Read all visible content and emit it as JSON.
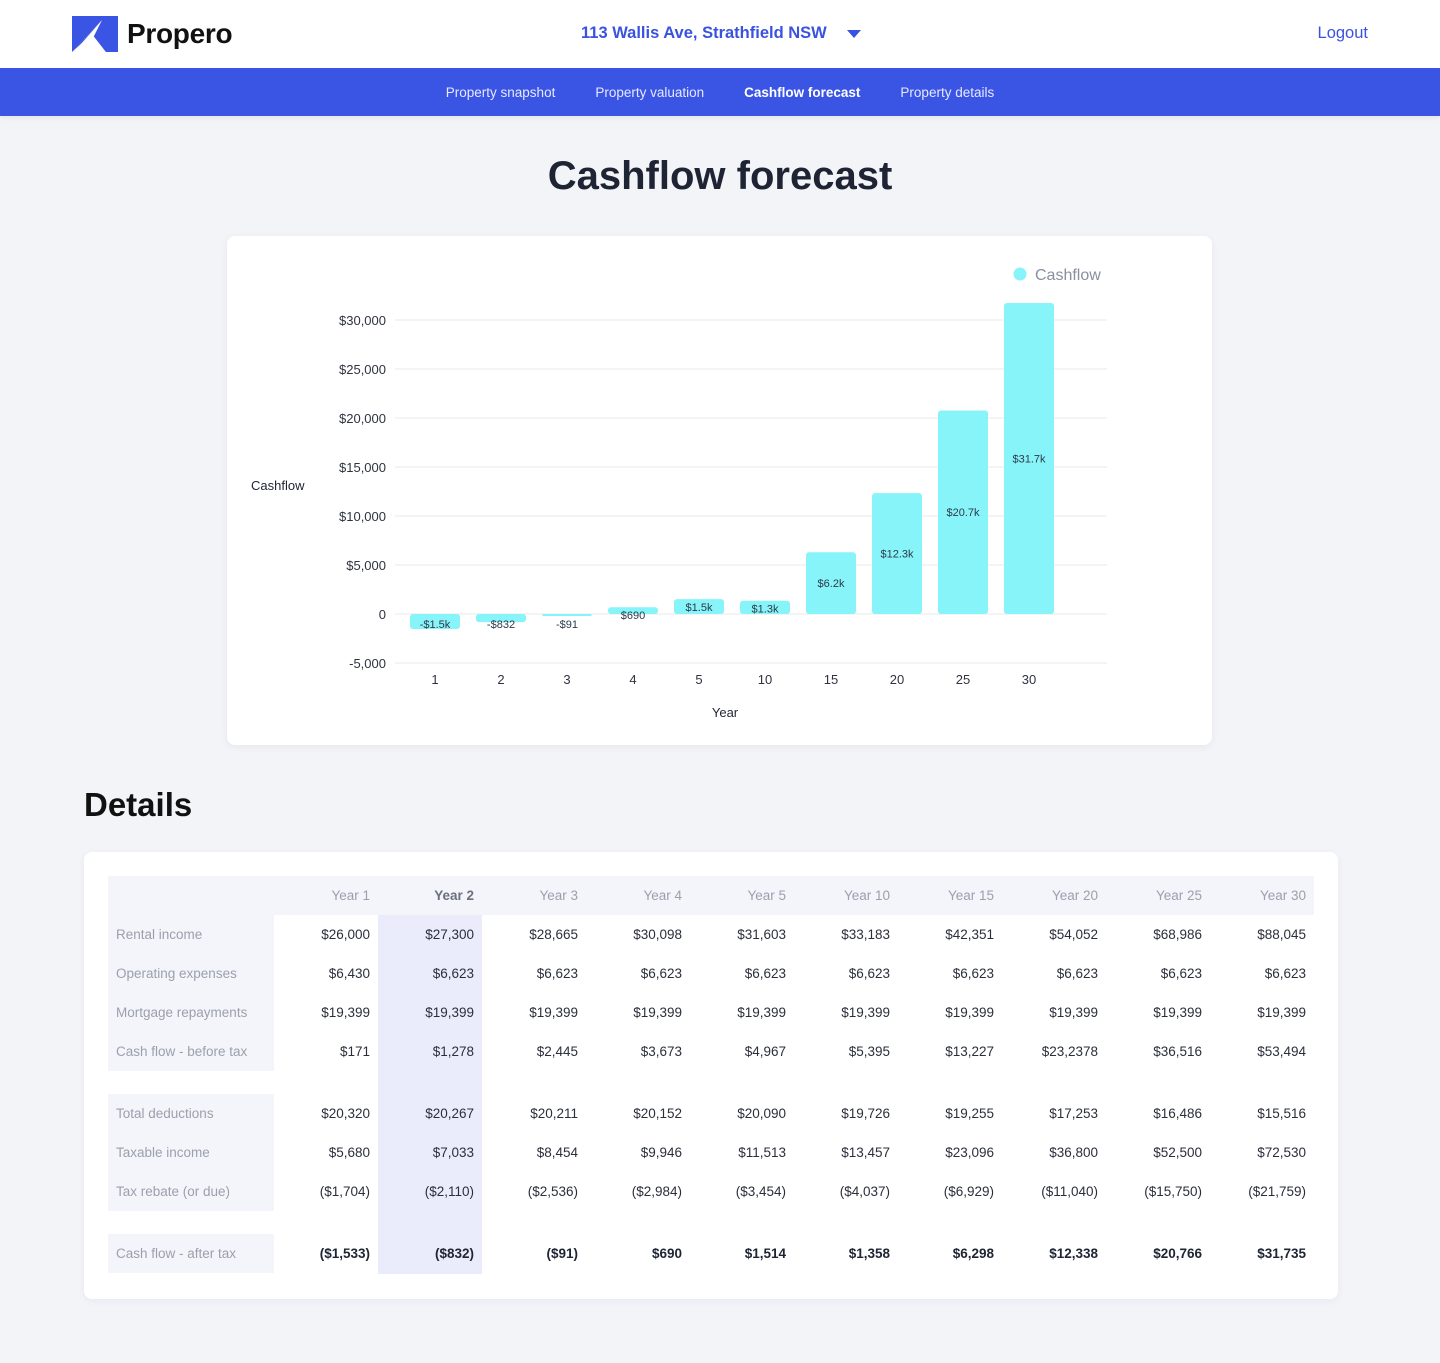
{
  "header": {
    "logo_text": "Propero",
    "address": "113 Wallis Ave, Strathfield NSW",
    "logout_label": "Logout"
  },
  "nav": {
    "items": [
      {
        "label": "Property snapshot",
        "active": false
      },
      {
        "label": "Property valuation",
        "active": false
      },
      {
        "label": "Cashflow forecast",
        "active": true
      },
      {
        "label": "Property details",
        "active": false
      }
    ]
  },
  "page": {
    "title": "Cashflow forecast",
    "details_title": "Details"
  },
  "colors": {
    "brand": "#3a55e4",
    "bar": "#86f4f8",
    "highlight_column": "#ebecfb"
  },
  "chart_data": {
    "type": "bar",
    "title": "",
    "xlabel": "Year",
    "ylabel": "Cashflow",
    "legend": [
      {
        "name": "Cashflow",
        "position": "top-right"
      }
    ],
    "categories": [
      "1",
      "2",
      "3",
      "4",
      "5",
      "10",
      "15",
      "20",
      "25",
      "30"
    ],
    "values": [
      -1533,
      -832,
      -91,
      690,
      1514,
      1358,
      6298,
      12338,
      20766,
      31735
    ],
    "data_labels": [
      "-$1.5k",
      "-$832",
      "-$91",
      "$690",
      "$1.5k",
      "$1.3k",
      "$6.2k",
      "$12.3k",
      "$20.7k",
      "$31.7k"
    ],
    "ylim": [
      -5000,
      30000
    ],
    "yticks": [
      30000,
      25000,
      20000,
      15000,
      10000,
      5000,
      0,
      -5000
    ],
    "ytick_labels": [
      "$30,000",
      "$25,000",
      "$20,000",
      "$15,000",
      "$10,000",
      "$5,000",
      "0",
      "-5,000"
    ],
    "grid": true
  },
  "table": {
    "columns": [
      "Year 1",
      "Year 2",
      "Year 3",
      "Year 4",
      "Year 5",
      "Year 10",
      "Year 15",
      "Year 20",
      "Year 25",
      "Year 30"
    ],
    "highlighted_column": "Year 2",
    "groups": [
      {
        "rows": [
          {
            "label": "Rental income",
            "values": [
              "$26,000",
              "$27,300",
              "$28,665",
              "$30,098",
              "$31,603",
              "$33,183",
              "$42,351",
              "$54,052",
              "$68,986",
              "$88,045"
            ]
          },
          {
            "label": "Operating expenses",
            "values": [
              "$6,430",
              "$6,623",
              "$6,623",
              "$6,623",
              "$6,623",
              "$6,623",
              "$6,623",
              "$6,623",
              "$6,623",
              "$6,623"
            ]
          },
          {
            "label": "Mortgage repayments",
            "values": [
              "$19,399",
              "$19,399",
              "$19,399",
              "$19,399",
              "$19,399",
              "$19,399",
              "$19,399",
              "$19,399",
              "$19,399",
              "$19,399"
            ]
          },
          {
            "label": "Cash flow - before tax",
            "values": [
              "$171",
              "$1,278",
              "$2,445",
              "$3,673",
              "$4,967",
              "$5,395",
              "$13,227",
              "$23,2378",
              "$36,516",
              "$53,494"
            ]
          }
        ]
      },
      {
        "rows": [
          {
            "label": "Total deductions",
            "values": [
              "$20,320",
              "$20,267",
              "$20,211",
              "$20,152",
              "$20,090",
              "$19,726",
              "$19,255",
              "$17,253",
              "$16,486",
              "$15,516"
            ]
          },
          {
            "label": "Taxable income",
            "values": [
              "$5,680",
              "$7,033",
              "$8,454",
              "$9,946",
              "$11,513",
              "$13,457",
              "$23,096",
              "$36,800",
              "$52,500",
              "$72,530"
            ]
          },
          {
            "label": "Tax rebate (or due)",
            "values": [
              "($1,704)",
              "($2,110)",
              "($2,536)",
              "($2,984)",
              "($3,454)",
              "($4,037)",
              "($6,929)",
              "($11,040)",
              "($15,750)",
              "($21,759)"
            ]
          }
        ]
      },
      {
        "bold": true,
        "rows": [
          {
            "label": "Cash flow - after tax",
            "values": [
              "($1,533)",
              "($832)",
              "($91)",
              "$690",
              "$1,514",
              "$1,358",
              "$6,298",
              "$12,338",
              "$20,766",
              "$31,735"
            ]
          }
        ]
      }
    ]
  }
}
